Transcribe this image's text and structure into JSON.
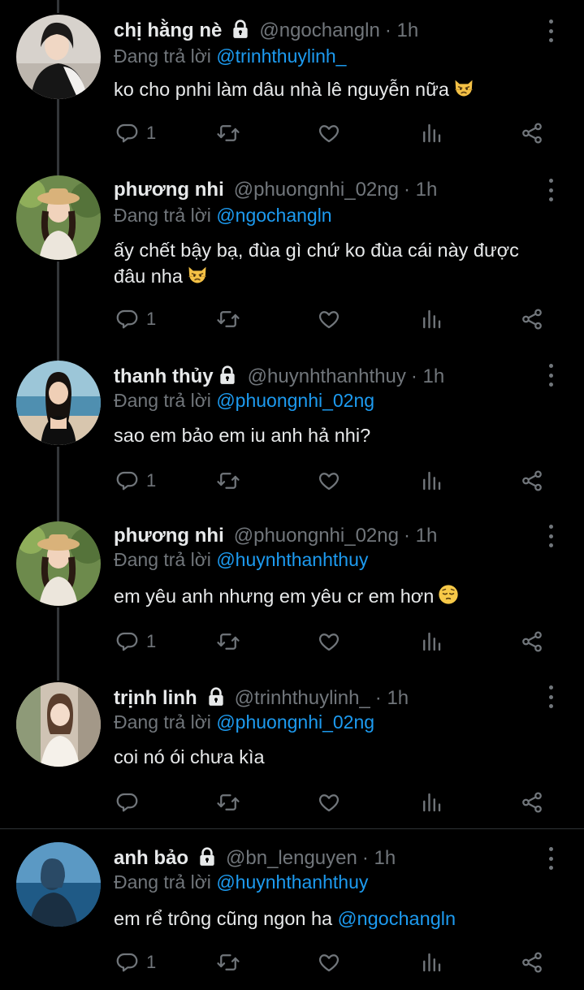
{
  "reply_prefix": "Đang trả lời",
  "tweets": [
    {
      "name": "chị hằng nè",
      "locked": true,
      "handle": "@ngochangln",
      "time": "· 1h",
      "reply_to": "@trinhthuylinh_",
      "text": "ko cho pnhi làm dâu nhà lê nguyễn nữa",
      "emoji": "pouting-cat",
      "reply_count": "1"
    },
    {
      "name": "phương nhi",
      "locked": false,
      "handle": "@phuongnhi_02ng",
      "time": "· 1h",
      "reply_to": "@ngochangln",
      "text": "ấy chết bậy bạ, đùa gì chứ ko đùa cái này được đâu nha",
      "emoji": "pouting-cat",
      "reply_count": "1"
    },
    {
      "name": "thanh thủy",
      "locked": true,
      "handle": "@huynhthanhthuy",
      "time": "· 1h",
      "reply_to": "@phuongnhi_02ng",
      "text": "sao em bảo em iu anh hả nhi?",
      "emoji": "",
      "reply_count": "1"
    },
    {
      "name": "phương nhi",
      "locked": false,
      "handle": "@phuongnhi_02ng",
      "time": "· 1h",
      "reply_to": "@huynhthanhthuy",
      "text": "em yêu anh nhưng em yêu cr em hơn",
      "emoji": "pensive-face",
      "reply_count": "1"
    },
    {
      "name": "trịnh linh",
      "locked": true,
      "handle": "@trinhthuylinh_",
      "time": "· 1h",
      "reply_to": "@phuongnhi_02ng",
      "text": "coi nó ói chưa kìa",
      "emoji": "",
      "reply_count": ""
    },
    {
      "name": "anh bảo",
      "locked": true,
      "handle": "@bn_lenguyen",
      "time": "· 1h",
      "reply_to": "@huynhthanhthuy",
      "text": "em rể trông cũng ngon ha",
      "text_mention": "@ngochangln",
      "emoji": "",
      "reply_count": "1"
    }
  ],
  "colors": {
    "background": "#000000",
    "text": "#e7e9ea",
    "muted": "#71767b",
    "accent": "#1d9bf0"
  },
  "icons": [
    "reply-icon",
    "retweet-icon",
    "like-icon",
    "analytics-icon",
    "share-icon",
    "more-icon",
    "lock-icon"
  ]
}
